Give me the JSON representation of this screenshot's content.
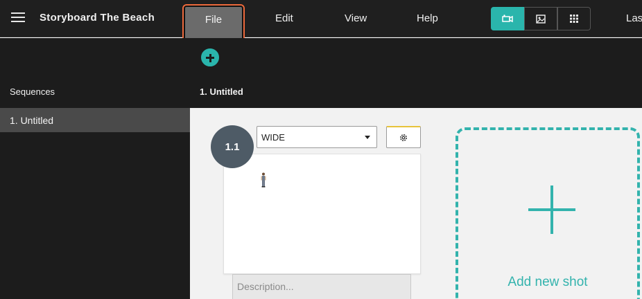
{
  "menubar": {
    "app_title": "Storyboard The Beach",
    "file": "File",
    "edit": "Edit",
    "view": "View",
    "help": "Help",
    "truncated_right": "Las",
    "view_modes": [
      {
        "icon": "camera-icon",
        "active": true
      },
      {
        "icon": "image-icon",
        "active": false
      },
      {
        "icon": "grid-icon",
        "active": false
      }
    ]
  },
  "sidebar": {
    "header": "Sequences",
    "items": [
      {
        "label": "1. Untitled",
        "selected": true
      }
    ]
  },
  "main": {
    "sequence_title": "1. Untitled",
    "shots": [
      {
        "number": "1.1",
        "shot_type": "WIDE",
        "description_placeholder": "Description..."
      }
    ],
    "add_shot_label": "Add new shot"
  },
  "colors": {
    "accent": "#2ab5ac",
    "highlight_outline": "#ee6a3c",
    "menubar_bg": "#1f1f1f"
  }
}
